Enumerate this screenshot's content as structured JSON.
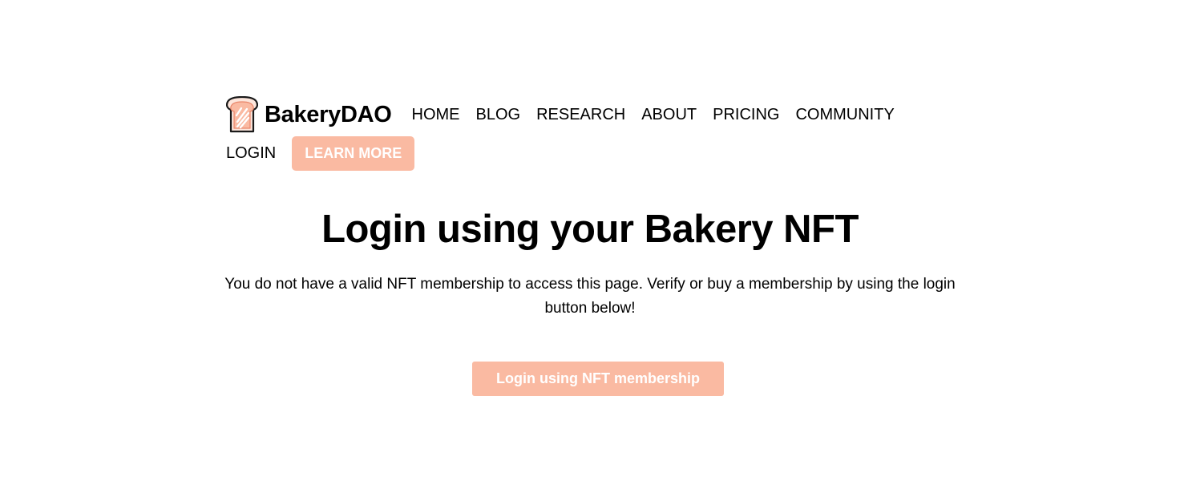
{
  "brand": {
    "name": "BakeryDAO",
    "logo_icon": "toast-bread-icon"
  },
  "nav": {
    "items": [
      {
        "label": "HOME"
      },
      {
        "label": "BLOG"
      },
      {
        "label": "RESEARCH"
      },
      {
        "label": "ABOUT"
      },
      {
        "label": "PRICING"
      },
      {
        "label": "COMMUNITY"
      }
    ],
    "login_label": "LOGIN",
    "learn_more_label": "LEARN MORE"
  },
  "main": {
    "title": "Login using your Bakery NFT",
    "description": "You do not have a valid NFT membership to access this page. Verify or buy a membership by using the login button below!",
    "cta_label": "Login using NFT membership"
  },
  "colors": {
    "accent": "#fabaa2",
    "text": "#000000",
    "background": "#ffffff"
  }
}
